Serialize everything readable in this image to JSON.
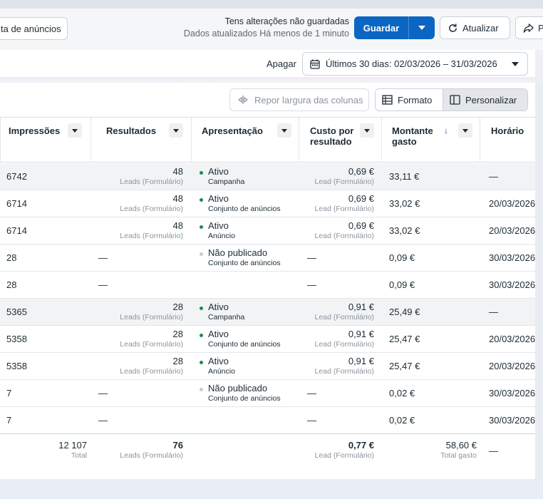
{
  "header": {
    "ad_list_button": "ta de anúncios",
    "unsaved_line1": "Tens alterações não guardadas",
    "unsaved_line2": "Dados atualizados Há menos de 1 minuto",
    "save_label": "Guardar",
    "refresh_label": "Atualizar",
    "share_label": "P"
  },
  "datebar": {
    "apagar_label": "Apagar",
    "date_range": "Últimos 30 dias: 02/03/2026 – 31/03/2026"
  },
  "toolbar": {
    "reset_label": "Repor largura das colunas",
    "format_label": "Formato",
    "customize_label": "Personalizar"
  },
  "columns": {
    "impressions": "Impressões",
    "results": "Resultados",
    "delivery": "Apresentação",
    "cost_line1": "Custo por",
    "cost_line2": "resultado",
    "spent_line1": "Montante",
    "spent_line2": "gasto",
    "schedule": "Horário"
  },
  "rows": [
    {
      "impressions": "6742",
      "results": "48",
      "results_sub": "Leads (Formulário)",
      "status": "Ativo",
      "level": "Campanha",
      "cost": "0,69 €",
      "cost_sub": "Lead (Formulário)",
      "spent": "33,11 €",
      "schedule": "—",
      "active": true,
      "shaded": true
    },
    {
      "impressions": "6714",
      "results": "48",
      "results_sub": "Leads (Formulário)",
      "status": "Ativo",
      "level": "Conjunto de anúncios",
      "cost": "0,69 €",
      "cost_sub": "Lead (Formulário)",
      "spent": "33,02 €",
      "schedule": "20/03/2026",
      "active": true,
      "shaded": false
    },
    {
      "impressions": "6714",
      "results": "48",
      "results_sub": "Leads (Formulário)",
      "status": "Ativo",
      "level": "Anúncio",
      "cost": "0,69 €",
      "cost_sub": "Lead (Formulário)",
      "spent": "33,02 €",
      "schedule": "20/03/2026",
      "active": true,
      "shaded": false
    },
    {
      "impressions": "28",
      "results": "—",
      "results_sub": "",
      "status": "Não publicado",
      "level": "Conjunto de anúncios",
      "cost": "—",
      "cost_sub": "",
      "spent": "0,09 €",
      "schedule": "30/03/2026",
      "active": false,
      "shaded": false
    },
    {
      "impressions": "28",
      "results": "—",
      "results_sub": "",
      "status": "",
      "level": "",
      "cost": "—",
      "cost_sub": "",
      "spent": "0,09 €",
      "schedule": "30/03/2026",
      "active": null,
      "shaded": false
    },
    {
      "impressions": "5365",
      "results": "28",
      "results_sub": "Leads (Formulário)",
      "status": "Ativo",
      "level": "Campanha",
      "cost": "0,91 €",
      "cost_sub": "Lead (Formulário)",
      "spent": "25,49 €",
      "schedule": "—",
      "active": true,
      "shaded": true
    },
    {
      "impressions": "5358",
      "results": "28",
      "results_sub": "Leads (Formulário)",
      "status": "Ativo",
      "level": "Conjunto de anúncios",
      "cost": "0,91 €",
      "cost_sub": "Lead (Formulário)",
      "spent": "25,47 €",
      "schedule": "20/03/2026",
      "active": true,
      "shaded": false
    },
    {
      "impressions": "5358",
      "results": "28",
      "results_sub": "Leads (Formulário)",
      "status": "Ativo",
      "level": "Anúncio",
      "cost": "0,91 €",
      "cost_sub": "Lead (Formulário)",
      "spent": "25,47 €",
      "schedule": "20/03/2026",
      "active": true,
      "shaded": false
    },
    {
      "impressions": "7",
      "results": "—",
      "results_sub": "",
      "status": "Não publicado",
      "level": "Conjunto de anúncios",
      "cost": "—",
      "cost_sub": "",
      "spent": "0,02 €",
      "schedule": "30/03/2026",
      "active": false,
      "shaded": false
    },
    {
      "impressions": "7",
      "results": "—",
      "results_sub": "",
      "status": "",
      "level": "",
      "cost": "—",
      "cost_sub": "",
      "spent": "0,02 €",
      "schedule": "30/03/2026",
      "active": null,
      "shaded": false
    }
  ],
  "totals": {
    "impressions": "12 107",
    "impressions_sub": "Total",
    "results": "76",
    "results_sub": "Leads (Formulário)",
    "cost": "0,77 €",
    "cost_sub": "Lead (Formulário)",
    "spent": "58,60 €",
    "spent_sub": "Total gasto",
    "schedule": "—"
  },
  "colors": {
    "accent": "#0a66c2",
    "active_dot": "#1f8a4c",
    "inactive_dot": "#c6cbd1"
  }
}
